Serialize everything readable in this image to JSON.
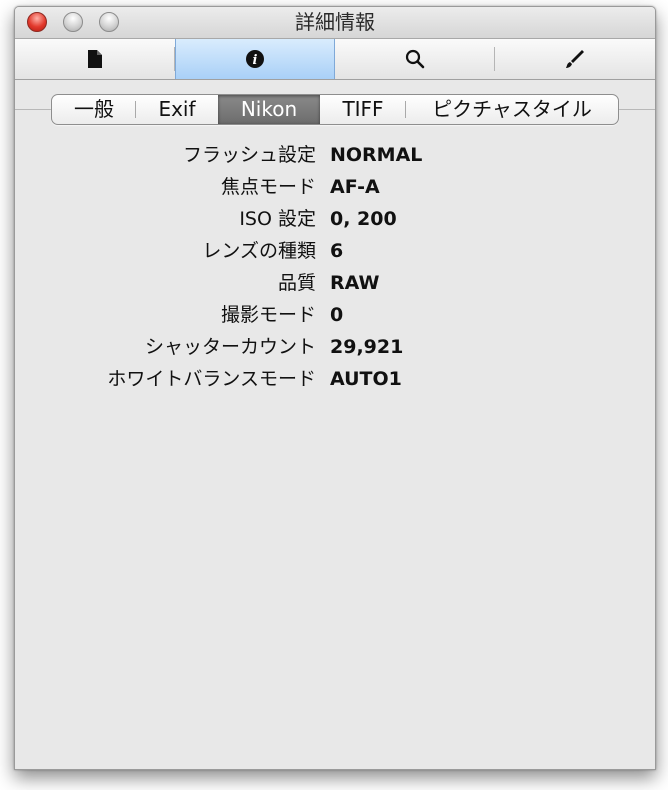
{
  "window": {
    "title": "詳細情報"
  },
  "toolbar": {
    "buttons": [
      {
        "icon": "document-icon",
        "active": false
      },
      {
        "icon": "info-icon",
        "active": true
      },
      {
        "icon": "search-icon",
        "active": false
      },
      {
        "icon": "brush-icon",
        "active": false
      }
    ],
    "active_color": "#a9d0f7"
  },
  "tabs": {
    "items": [
      {
        "label": "一般"
      },
      {
        "label": "Exif"
      },
      {
        "label": "Nikon"
      },
      {
        "label": "TIFF"
      },
      {
        "label": "ピクチャスタイル"
      }
    ],
    "selected": "Nikon"
  },
  "properties": [
    {
      "label": "フラッシュ設定",
      "value": "NORMAL"
    },
    {
      "label": "焦点モード",
      "value": "AF-A"
    },
    {
      "label": "ISO 設定",
      "value": "0, 200"
    },
    {
      "label": "レンズの種類",
      "value": "6"
    },
    {
      "label": "品質",
      "value": "RAW"
    },
    {
      "label": "撮影モード",
      "value": "0"
    },
    {
      "label": "シャッターカウント",
      "value": "29,921"
    },
    {
      "label": "ホワイトバランスモード",
      "value": "AUTO1"
    }
  ]
}
